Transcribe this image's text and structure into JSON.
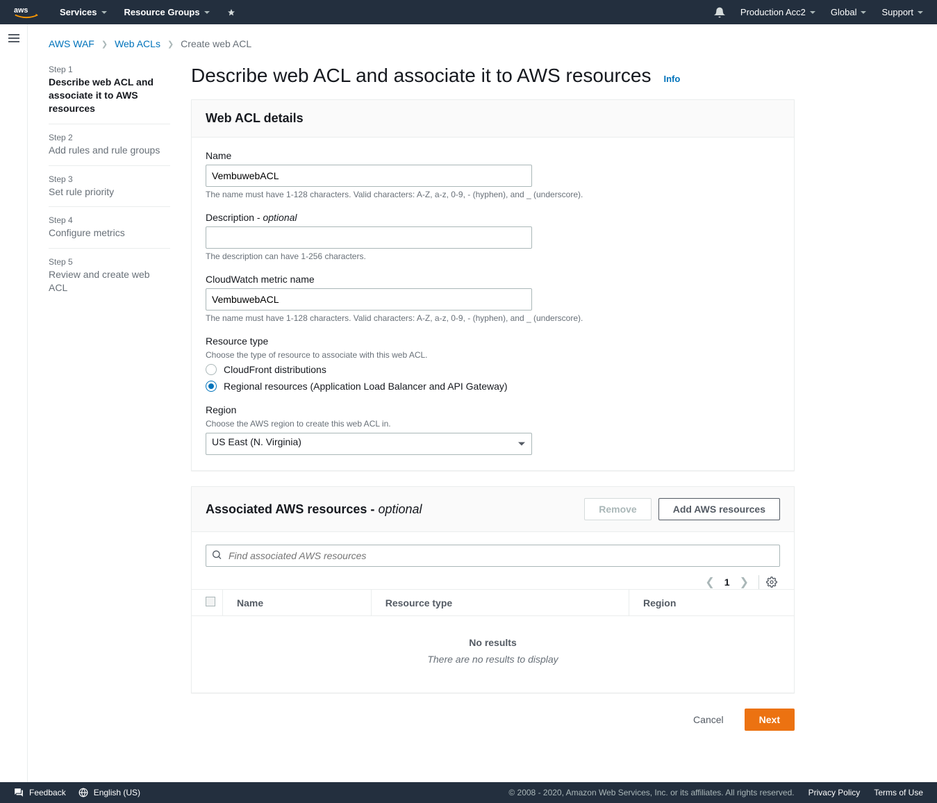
{
  "topnav": {
    "services": "Services",
    "resource_groups": "Resource Groups",
    "account": "Production Acc2",
    "region": "Global",
    "support": "Support"
  },
  "breadcrumb": {
    "waf": "AWS WAF",
    "webacls": "Web ACLs",
    "current": "Create web ACL"
  },
  "wizard": {
    "step1_num": "Step 1",
    "step1_title": "Describe web ACL and associate it to AWS resources",
    "step2_num": "Step 2",
    "step2_title": "Add rules and rule groups",
    "step3_num": "Step 3",
    "step3_title": "Set rule priority",
    "step4_num": "Step 4",
    "step4_title": "Configure metrics",
    "step5_num": "Step 5",
    "step5_title": "Review and create web ACL"
  },
  "page": {
    "title": "Describe web ACL and associate it to AWS resources",
    "info": "Info"
  },
  "details": {
    "panel_title": "Web ACL details",
    "name_label": "Name",
    "name_value": "VembuwebACL",
    "name_help": "The name must have 1-128 characters. Valid characters: A-Z, a-z, 0-9, - (hyphen), and _ (underscore).",
    "desc_label": "Description - ",
    "desc_optional": "optional",
    "desc_value": "",
    "desc_help": "The description can have 1-256 characters.",
    "metric_label": "CloudWatch metric name",
    "metric_value": "VembuwebACL",
    "metric_help": "The name must have 1-128 characters. Valid characters: A-Z, a-z, 0-9, - (hyphen), and _ (underscore).",
    "rtype_label": "Resource type",
    "rtype_desc": "Choose the type of resource to associate with this web ACL.",
    "rtype_opt1": "CloudFront distributions",
    "rtype_opt2": "Regional resources (Application Load Balancer and API Gateway)",
    "region_label": "Region",
    "region_desc": "Choose the AWS region to create this web ACL in.",
    "region_value": "US East (N. Virginia)"
  },
  "assoc": {
    "panel_title": "Associated AWS resources - ",
    "panel_optional": "optional",
    "remove": "Remove",
    "add": "Add AWS resources",
    "search_placeholder": "Find associated AWS resources",
    "page_num": "1",
    "col_name": "Name",
    "col_type": "Resource type",
    "col_region": "Region",
    "no_results_title": "No results",
    "no_results_sub": "There are no results to display"
  },
  "actions": {
    "cancel": "Cancel",
    "next": "Next"
  },
  "footer": {
    "feedback": "Feedback",
    "language": "English (US)",
    "copyright": "© 2008 - 2020, Amazon Web Services, Inc. or its affiliates. All rights reserved.",
    "privacy": "Privacy Policy",
    "terms": "Terms of Use"
  }
}
